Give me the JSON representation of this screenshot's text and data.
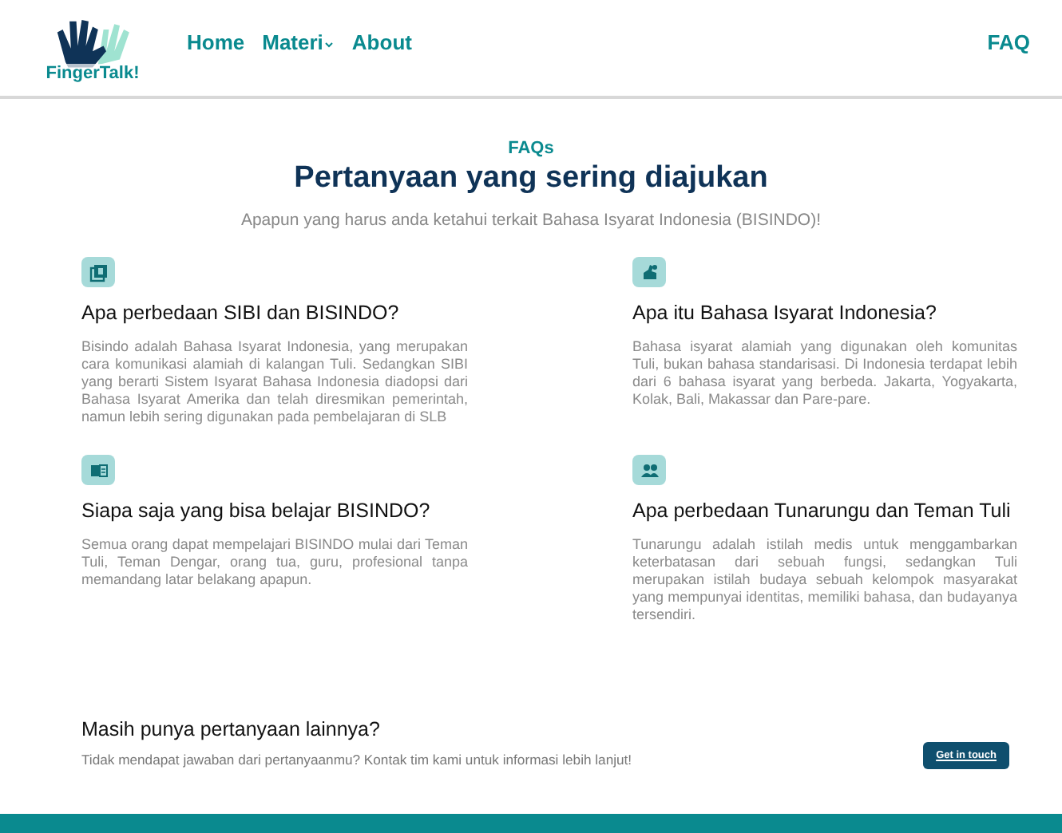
{
  "logo": {
    "text": "FingerTalk!"
  },
  "nav": {
    "items": [
      {
        "label": "Home",
        "dropdown": false
      },
      {
        "label": "Materi",
        "dropdown": true
      },
      {
        "label": "About",
        "dropdown": false
      }
    ],
    "right": "FAQ"
  },
  "hero": {
    "eyebrow": "FAQs",
    "title": "Pertanyaan yang sering diajukan",
    "subtitle": "Apapun yang harus anda ketahui terkait Bahasa Isyarat Indonesia (BISINDO)!"
  },
  "faqs": [
    {
      "question": "Apa perbedaan SIBI dan BISINDO?",
      "answer": "Bisindo adalah Bahasa Isyarat Indonesia, yang merupakan cara komunikasi alamiah di kalangan Tuli. Sedangkan SIBI yang berarti Sistem Isyarat Bahasa Indonesia diadopsi dari Bahasa Isyarat Amerika dan telah diresmikan pemerintah, namun lebih sering digunakan pada pembelajaran di SLB"
    },
    {
      "question": "Apa itu Bahasa Isyarat Indonesia?",
      "answer": "Bahasa isyarat alamiah yang digunakan oleh komunitas Tuli, bukan bahasa standarisasi. Di Indonesia terdapat lebih dari 6 bahasa isyarat yang berbeda. Jakarta, Yogyakarta, Kolak, Bali, Makassar dan Pare-pare."
    },
    {
      "question": "Siapa saja yang bisa belajar BISINDO?",
      "answer": "Semua orang dapat mempelajari BISINDO mulai dari Teman Tuli, Teman Dengar, orang tua, guru, profesional tanpa memandang latar belakang apapun."
    },
    {
      "question": "Apa perbedaan Tunarungu dan Teman Tuli",
      "answer": "Tunarungu adalah istilah medis untuk menggambarkan keterbatasan dari sebuah fungsi, sedangkan Tuli merupakan istilah budaya sebuah kelompok masyarakat yang mempunyai identitas, memiliki bahasa, dan budayanya tersendiri."
    }
  ],
  "contact": {
    "title": "Masih punya pertanyaan lainnya?",
    "text": "Tidak mendapat jawaban dari pertanyaanmu? Kontak tim kami untuk informasi lebih lanjut!",
    "button": "Get in touch"
  }
}
